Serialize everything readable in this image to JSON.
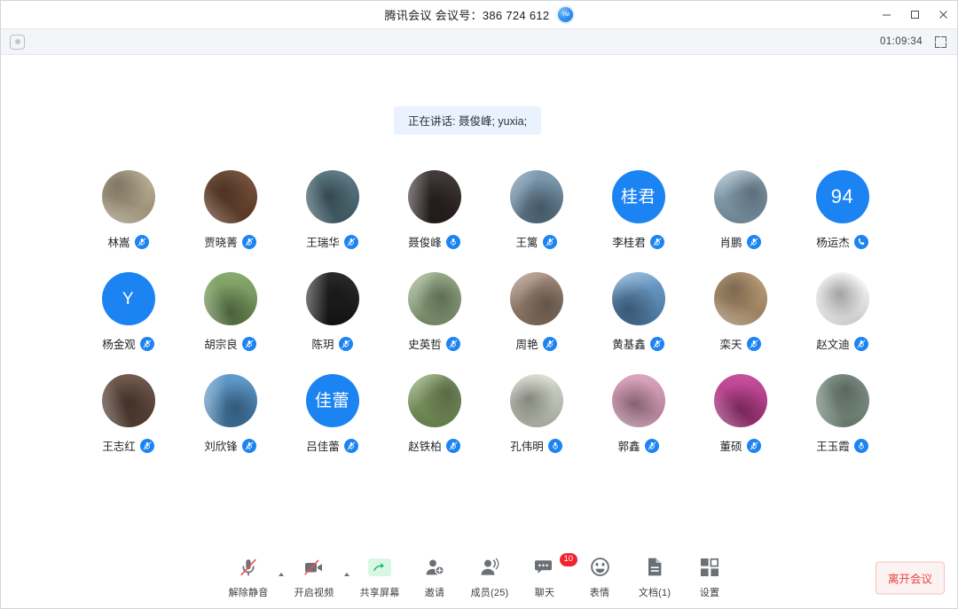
{
  "window": {
    "title": "腾讯会议 会议号：386 724 612",
    "badge_icon": "tencent-meeting-logo-icon",
    "minimize": "minimize-icon",
    "maximize": "maximize-icon",
    "close": "close-icon"
  },
  "subheader": {
    "left_icon": "record-status-icon",
    "timer": "01:09:34",
    "fullscreen_icon": "fullscreen-icon"
  },
  "stage": {
    "speaking_banner": "正在讲话: 聂俊峰; yuxia;"
  },
  "participants": [
    {
      "name": "林嵩",
      "avatar_type": "photo",
      "avatar_text": "",
      "bg": "#b9ab8c",
      "mic": "muted"
    },
    {
      "name": "贾晓菁",
      "avatar_type": "photo",
      "avatar_text": "",
      "bg": "#6b4128",
      "mic": "muted"
    },
    {
      "name": "王瑞华",
      "avatar_type": "photo",
      "avatar_text": "",
      "bg": "#4a6a77",
      "mic": "muted"
    },
    {
      "name": "聂俊峰",
      "avatar_type": "photo",
      "avatar_text": "",
      "bg": "#2a2120",
      "mic": "active"
    },
    {
      "name": "王篱",
      "avatar_type": "photo",
      "avatar_text": "",
      "bg": "#6e8fa8",
      "mic": "muted"
    },
    {
      "name": "李桂君",
      "avatar_type": "initials",
      "avatar_text": "桂君",
      "bg": "#1c84f2",
      "mic": "muted"
    },
    {
      "name": "肖鹏",
      "avatar_type": "photo",
      "avatar_text": "",
      "bg": "#8aa6ba",
      "mic": "muted"
    },
    {
      "name": "杨运杰",
      "avatar_type": "initials",
      "avatar_text": "94",
      "bg": "#1c84f2",
      "mic": "phone"
    },
    {
      "name": "杨金观",
      "avatar_type": "initials",
      "avatar_text": "Y",
      "bg": "#1c84f2",
      "mic": "muted"
    },
    {
      "name": "胡宗良",
      "avatar_type": "photo",
      "avatar_text": "",
      "bg": "#79a05c",
      "mic": "muted"
    },
    {
      "name": "陈玥",
      "avatar_type": "photo",
      "avatar_text": "",
      "bg": "#141414",
      "mic": "muted"
    },
    {
      "name": "史英哲",
      "avatar_type": "photo",
      "avatar_text": "",
      "bg": "#8fa87e",
      "mic": "muted"
    },
    {
      "name": "周艳",
      "avatar_type": "photo",
      "avatar_text": "",
      "bg": "#9c8270",
      "mic": "muted"
    },
    {
      "name": "黄基鑫",
      "avatar_type": "photo",
      "avatar_text": "",
      "bg": "#5b93c4",
      "mic": "muted"
    },
    {
      "name": "栾天",
      "avatar_type": "photo",
      "avatar_text": "",
      "bg": "#b9976d",
      "mic": "muted"
    },
    {
      "name": "赵文迪",
      "avatar_type": "photo",
      "avatar_text": "",
      "bg": "#ffffff",
      "mic": "muted"
    },
    {
      "name": "王志红",
      "avatar_type": "photo",
      "avatar_text": "",
      "bg": "#5d4436",
      "mic": "muted"
    },
    {
      "name": "刘欣锋",
      "avatar_type": "photo",
      "avatar_text": "",
      "bg": "#4b8ec4",
      "mic": "muted"
    },
    {
      "name": "吕佳蕾",
      "avatar_type": "initials",
      "avatar_text": "佳蕾",
      "bg": "#1c84f2",
      "mic": "muted"
    },
    {
      "name": "赵铁柏",
      "avatar_type": "photo",
      "avatar_text": "",
      "bg": "#7f9c5e",
      "mic": "muted"
    },
    {
      "name": "孔伟明",
      "avatar_type": "photo",
      "avatar_text": "",
      "bg": "#cfd3c4",
      "mic": "active"
    },
    {
      "name": "郭鑫",
      "avatar_type": "photo",
      "avatar_text": "",
      "bg": "#d79ab4",
      "mic": "muted"
    },
    {
      "name": "董硕",
      "avatar_type": "photo",
      "avatar_text": "",
      "bg": "#c0388f",
      "mic": "muted"
    },
    {
      "name": "王玉霞",
      "avatar_type": "photo",
      "avatar_text": "",
      "bg": "#7e9486",
      "mic": "active"
    }
  ],
  "toolbar": {
    "unmute": {
      "label": "解除静音",
      "icon": "microphone-off-icon"
    },
    "video": {
      "label": "开启视频",
      "icon": "camera-off-icon"
    },
    "share": {
      "label": "共享屏幕",
      "icon": "share-screen-icon"
    },
    "invite": {
      "label": "邀请",
      "icon": "invite-user-icon"
    },
    "members": {
      "label": "成员(25)",
      "icon": "members-icon"
    },
    "chat": {
      "label": "聊天",
      "icon": "chat-icon",
      "badge": "10"
    },
    "emoji": {
      "label": "表情",
      "icon": "emoji-icon"
    },
    "docs": {
      "label": "文档(1)",
      "icon": "document-icon"
    },
    "settings": {
      "label": "设置",
      "icon": "apps-grid-icon"
    },
    "leave": {
      "label": "离开会议"
    }
  },
  "colors": {
    "accent": "#1c84f2",
    "danger": "#e8423f",
    "banner_bg": "#eaf2fd",
    "share_green": "#19b36b"
  }
}
